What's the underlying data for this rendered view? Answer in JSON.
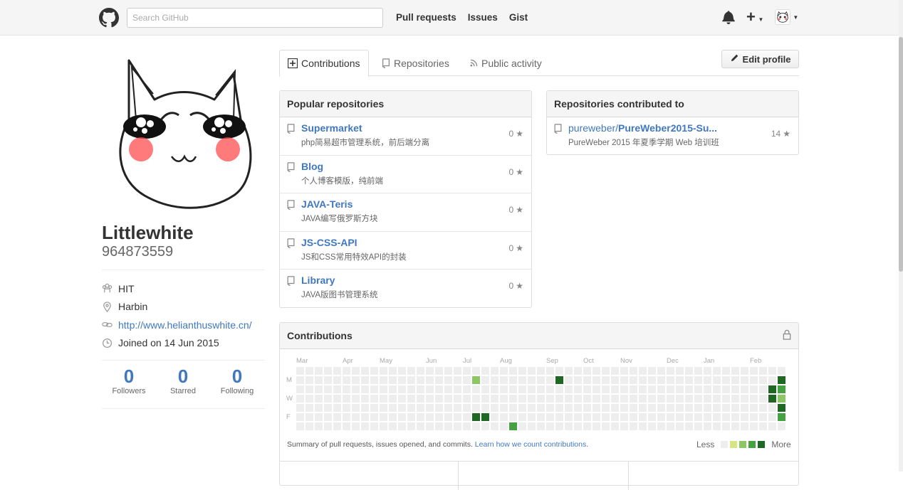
{
  "header": {
    "search_placeholder": "Search GitHub",
    "nav": [
      "Pull requests",
      "Issues",
      "Gist"
    ],
    "plus": "+",
    "icons": [
      "github-logo-icon",
      "bell-icon",
      "plus-icon",
      "avatar"
    ]
  },
  "profile": {
    "fullname": "Littlewhite",
    "username": "964873559",
    "details": [
      {
        "icon": "organization-icon",
        "text": "HIT",
        "link": false
      },
      {
        "icon": "location-icon",
        "text": "Harbin",
        "link": false
      },
      {
        "icon": "link-icon",
        "text": "http://www.helianthuswhite.cn/",
        "link": true
      },
      {
        "icon": "clock-icon",
        "text": "Joined on 14 Jun 2015",
        "link": false
      }
    ],
    "stats": [
      {
        "value": "0",
        "label": "Followers"
      },
      {
        "value": "0",
        "label": "Starred"
      },
      {
        "value": "0",
        "label": "Following"
      }
    ]
  },
  "tabs": {
    "contributions": "Contributions",
    "repositories": "Repositories",
    "activity": "Public activity",
    "edit_profile": "Edit profile"
  },
  "popular": {
    "title": "Popular repositories",
    "repos": [
      {
        "name": "Supermarket",
        "desc": "php简易超市管理系统，前后端分离",
        "stars": "0"
      },
      {
        "name": "Blog",
        "desc": "个人博客模版，纯前端",
        "stars": "0"
      },
      {
        "name": "JAVA-Teris",
        "desc": "JAVA编写俄罗斯方块",
        "stars": "0"
      },
      {
        "name": "JS-CSS-API",
        "desc": "JS和CSS常用特效API的封装",
        "stars": "0"
      },
      {
        "name": "Library",
        "desc": "JAVA版图书管理系统",
        "stars": "0"
      }
    ]
  },
  "contributed": {
    "title": "Repositories contributed to",
    "repos": [
      {
        "owner": "pureweber/",
        "name": "PureWeber2015-Su...",
        "desc": "PureWeber 2015 年夏季学期 Web 培训班",
        "stars": "14"
      }
    ]
  },
  "contributions": {
    "title": "Contributions",
    "months": [
      "Mar",
      "Apr",
      "May",
      "Jun",
      "Jul",
      "Aug",
      "Sep",
      "Oct",
      "Nov",
      "Dec",
      "Jan",
      "Feb"
    ],
    "days": [
      "M",
      "W",
      "F"
    ],
    "summary": "Summary of pull requests, issues opened, and commits.",
    "learn_link": "Learn how we count contributions",
    "less": "Less",
    "more": "More",
    "colors": [
      "#eeeeee",
      "#d6e685",
      "#8cc665",
      "#44a340",
      "#1e6823"
    ],
    "weeks": 53,
    "active_cells": [
      {
        "week": 19,
        "day": 1,
        "level": 2
      },
      {
        "week": 19,
        "day": 5,
        "level": 4
      },
      {
        "week": 20,
        "day": 5,
        "level": 4
      },
      {
        "week": 23,
        "day": 6,
        "level": 3
      },
      {
        "week": 28,
        "day": 1,
        "level": 4
      },
      {
        "week": 51,
        "day": 2,
        "level": 4
      },
      {
        "week": 51,
        "day": 3,
        "level": 4
      },
      {
        "week": 52,
        "day": 1,
        "level": 4
      },
      {
        "week": 52,
        "day": 2,
        "level": 3
      },
      {
        "week": 52,
        "day": 3,
        "level": 2
      },
      {
        "week": 52,
        "day": 4,
        "level": 4
      },
      {
        "week": 52,
        "day": 5,
        "level": 3
      }
    ]
  }
}
